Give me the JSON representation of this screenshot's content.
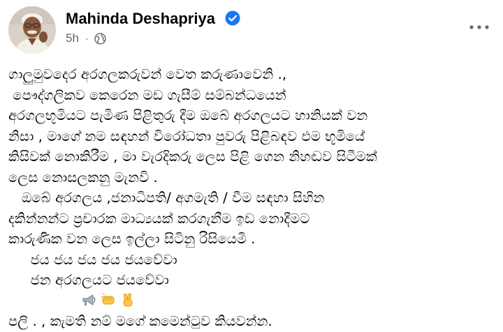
{
  "post": {
    "author": "Mahinda Deshapriya",
    "verified": true,
    "time": "5h",
    "separator": "·",
    "audience_icon": "globe-icon",
    "more_icon": "more-options-icon",
    "body_lines": [
      "ගාලුමුවදෙර අරගලකරුවන් වෙත කරුණාවෙනි .,",
      " පෞද්ගලිකව කෙරෙන මඩ ගැසීම් සම්බන්ධයෙන්",
      "අරගලභූමියට පැමිණ පිළිතුරු දීම ඔබේ අරගලයට හානියක් වන",
      "නිසා , මාගේ නම සඳහන් විරෝධතා පුවරු පිළිබඳව එම භූමියේ",
      "කිසිවක් නොකිරීම , මා වැරදිකරු ලෙස පිළි ගෙන නිහඬව සිටීමක්",
      "ලෙස නොසලකනු මැනවි .",
      "   ඔබේ අරගලය ,ජනාධිපති/ අගමැති / වීම සඳහා සිහින",
      "දකින්නන්ට ප්‍රචාරක මාධ්‍යයක් කරගැනීම ඉඩ නොදීමට",
      "කාරුණික වන ලෙස ඉල්ලා සිටිනු රිසියෙමි .",
      "     ජය ජය ජය ජය ජයවේවා",
      "     ජන අරගලයට ජයවේවා"
    ],
    "emojis": [
      "loudspeaker-emoji",
      "fist-emoji",
      "victory-hand-emoji"
    ],
    "closing_line": "පලි . , කැමති නම් මගේ කමෙන්ටුව කියවන්න."
  },
  "colors": {
    "name": "#050505",
    "meta": "#65676b",
    "verified": "#1877f2"
  }
}
